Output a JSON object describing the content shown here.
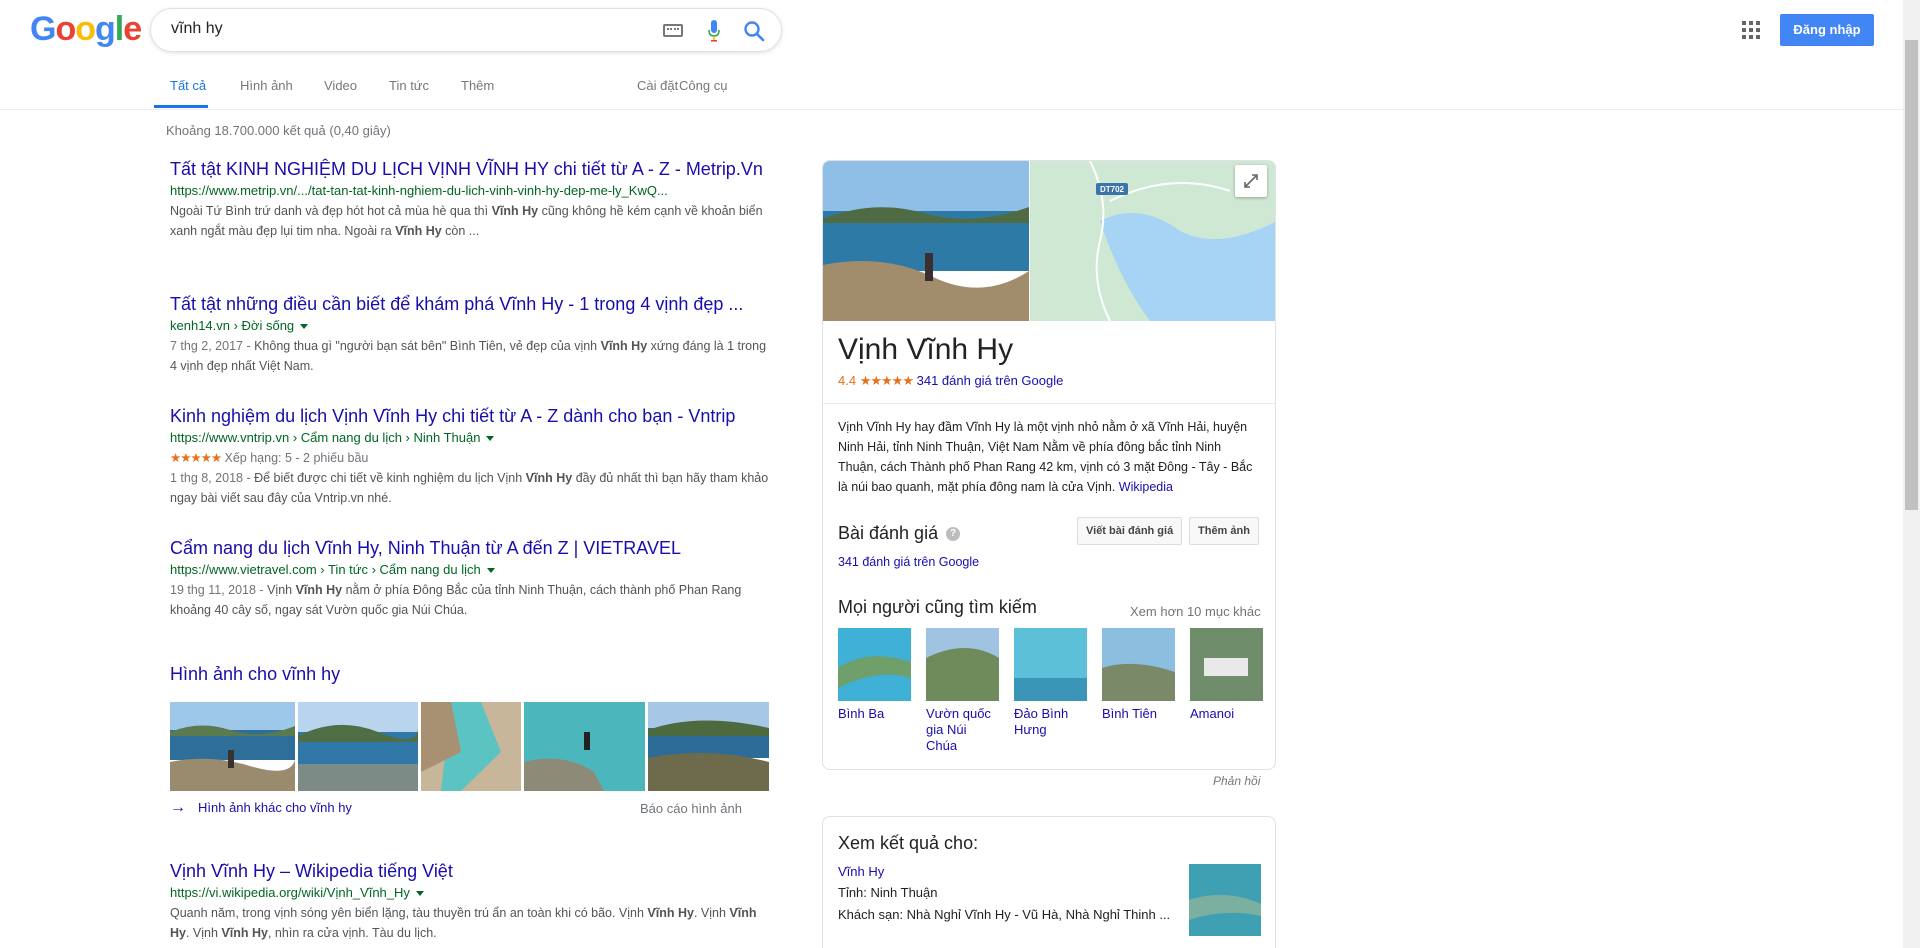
{
  "search": {
    "query": "vĩnh hy"
  },
  "logo": {
    "text": "Google"
  },
  "header": {
    "signin_label": "Đăng nhập"
  },
  "tabs": [
    {
      "label": "Tất cả"
    },
    {
      "label": "Hình ảnh"
    },
    {
      "label": "Video"
    },
    {
      "label": "Tin tức"
    },
    {
      "label": "Thêm"
    },
    {
      "label": "Cài đặt"
    },
    {
      "label": "Công cụ"
    }
  ],
  "stats": "Khoảng 18.700.000 kết quả (0,40 giây)",
  "results": [
    {
      "title": "Tất tật KINH NGHIỆM DU LỊCH VỊNH VĨNH HY chi tiết từ A - Z - Metrip.Vn",
      "url": "https://www.metrip.vn/.../tat-tan-tat-kinh-nghiem-du-lich-vinh-vinh-hy-dep-me-ly_KwQ...",
      "snippet_1": "Ngoài Tứ Bình trứ danh và đẹp hót hot cả mùa hè qua thì ",
      "snippet_bold_1": "Vĩnh Hy",
      "snippet_2": " cũng không hề kém cạnh về khoản biển xanh ngắt màu đẹp lụi tim nha. Ngoài ra ",
      "snippet_bold_2": "Vĩnh Hy",
      "snippet_3": " còn ..."
    },
    {
      "title": "Tất tật những điều cần biết để khám phá Vĩnh Hy - 1 trong 4 vịnh đẹp ...",
      "url": "kenh14.vn › Đời sống",
      "date": "7 thg 2, 2017 - ",
      "snippet_1": "Không thua gì \"người bạn sát bên\" Bình Tiên, vẻ đẹp của vịnh ",
      "snippet_bold_1": "Vĩnh Hy",
      "snippet_2": " xứng đáng là 1 trong 4 vịnh đẹp nhất Việt Nam."
    },
    {
      "title": "Kinh nghiệm du lịch Vịnh Vĩnh Hy chi tiết từ A - Z dành cho bạn - Vntrip",
      "url": "https://www.vntrip.vn › Cẩm nang du lịch › Ninh Thuận",
      "rating_stars": "★★★★★",
      "rating_text": " Xếp hạng: 5 - 2 phiếu bầu",
      "rating_value": 5,
      "date": "1 thg 8, 2018 - ",
      "snippet_1": "Để biết được chi tiết về kinh nghiệm du lịch Vịnh ",
      "snippet_bold_1": "Vĩnh Hy",
      "snippet_2": " đầy đủ nhất thì bạn hãy tham khảo ngay bài viết sau đây của Vntrip.vn nhé."
    },
    {
      "title": "Cẩm nang du lịch Vĩnh Hy, Ninh Thuận từ A đến Z | VIETRAVEL",
      "url": "https://www.vietravel.com › Tin tức › Cẩm nang du lịch",
      "date": "19 thg 11, 2018 - ",
      "snippet_1": "Vịnh ",
      "snippet_bold_1": "Vĩnh Hy",
      "snippet_2": " nằm ở phía Đông Bắc của tỉnh Ninh Thuận, cách thành phố Phan Rang khoảng 40 cây số, ngay sát Vườn quốc gia Núi Chúa."
    },
    {
      "title": "Vịnh Vĩnh Hy – Wikipedia tiếng Việt",
      "url": "https://vi.wikipedia.org/wiki/Vịnh_Vĩnh_Hy",
      "snippet_1": "Quanh năm, trong vịnh sóng yên biển lặng, tàu thuyền trú ẩn an toàn khi có bão. Vịnh ",
      "snippet_bold_1": "Vĩnh Hy",
      "snippet_2": ". Vịnh ",
      "snippet_bold_2": "Vĩnh Hy",
      "snippet_3": ". Vịnh ",
      "snippet_bold_3": "Vĩnh Hy",
      "snippet_4": ", nhìn ra cửa vịnh. Tàu du lịch."
    }
  ],
  "images": {
    "title": "Hình ảnh cho vĩnh hy",
    "more_label": "Hình ảnh khác cho vĩnh hy",
    "report_label": "Báo cáo hình ảnh"
  },
  "kp": {
    "title": "Vịnh Vĩnh Hy",
    "rating_score": "4.4",
    "rating_value": 4.4,
    "rating_stars": "★★★★★",
    "rating_reviews": "341 đánh giá trên Google",
    "map_label": "DT702",
    "description": "Vịnh Vĩnh Hy hay đầm Vĩnh Hy là một vịnh nhỏ nằm ở xã Vĩnh Hải, huyện Ninh Hải, tỉnh Ninh Thuận, Việt Nam Nằm về phía đông bắc tỉnh Ninh Thuận, cách Thành phố Phan Rang 42 km, vịnh có 3 mặt Đông - Tây - Bắc là núi bao quanh, mặt phía đông nam là cửa Vịnh. ",
    "wiki_link": "Wikipedia",
    "reviews_heading": "Bài đánh giá",
    "write_review_btn": "Viết bài đánh giá",
    "add_photo_btn": "Thêm ảnh",
    "reviews_link": "341 đánh giá trên Google",
    "also_heading": "Mọi người cũng tìm kiếm",
    "also_more": "Xem hơn 10 mục khác",
    "also_items": [
      {
        "line1": "Bình Ba",
        "line2": "",
        "line3": ""
      },
      {
        "line1": "Vườn quốc",
        "line2": "gia Núi",
        "line3": "Chúa"
      },
      {
        "line1": "Đảo Bình",
        "line2": "Hưng",
        "line3": ""
      },
      {
        "line1": "Bình Tiên",
        "line2": "",
        "line3": ""
      },
      {
        "line1": "Amanoi",
        "line2": "",
        "line3": ""
      }
    ]
  },
  "feedback": "Phản hồi",
  "kp2": {
    "heading": "Xem kết quả cho:",
    "link": "Vĩnh Hy",
    "province_label": "Tỉnh",
    "province_value": ": Ninh Thuận",
    "hotels_label": "Khách sạn",
    "hotels_value": ": Nhà Nghỉ Vĩnh Hy - Vũ Hà, Nhà Nghỉ Thinh ..."
  },
  "colors": {
    "link": "#1a0dab",
    "url_green": "#006621",
    "accent_blue": "#1a73e8",
    "star_orange": "#e7711b",
    "signin_blue": "#4285f4"
  }
}
